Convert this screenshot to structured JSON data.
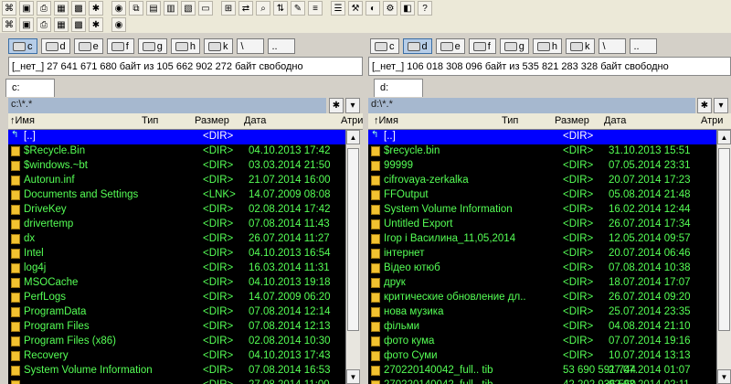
{
  "toolbar1": [
    "cmd-icon",
    "save-icon",
    "print-icon",
    "grid-icon",
    "grid2-icon",
    "star-icon",
    "globe-icon",
    "copy-icon",
    "disk-icon",
    "pack-icon",
    "unpack-icon",
    "terminal-icon",
    "tree-icon",
    "sync-icon",
    "search-icon",
    "ftp-icon",
    "edit-icon",
    "compare-icon",
    "notes-icon",
    "tools-icon",
    "color-icon",
    "settings-icon",
    "view-icon",
    "help-icon"
  ],
  "toolbar2": [
    "network-icon",
    "info-icon",
    "task-icon",
    "clock-icon",
    "web-icon",
    "bug-icon",
    "chip-icon"
  ],
  "left": {
    "drives": [
      {
        "label": "c",
        "active": true
      },
      {
        "label": "d",
        "active": false
      },
      {
        "label": "e",
        "active": false
      },
      {
        "label": "f",
        "active": false
      },
      {
        "label": "g",
        "active": false
      },
      {
        "label": "h",
        "active": false
      },
      {
        "label": "k",
        "active": false
      },
      {
        "label": "\\",
        "active": false
      },
      {
        "label": "..",
        "active": false
      }
    ],
    "free": "[_нет_]  27 641 671 680 байт из 105 662 902 272 байт свободно",
    "tab": "c:",
    "path": "c:\\*.*",
    "rows": [
      {
        "name": "[..]",
        "size": "<DIR>",
        "date": "",
        "up": true,
        "sel": true
      },
      {
        "name": "$Recycle.Bin",
        "size": "<DIR>",
        "date": "04.10.2013 17:42"
      },
      {
        "name": "$windows.~bt",
        "size": "<DIR>",
        "date": "03.03.2014 21:50"
      },
      {
        "name": "Autorun.inf",
        "size": "<DIR>",
        "date": "21.07.2014 16:00"
      },
      {
        "name": "Documents and Settings",
        "size": "<LNK>",
        "date": "14.07.2009 08:08"
      },
      {
        "name": "DriveKey",
        "size": "<DIR>",
        "date": "02.08.2014 17:42"
      },
      {
        "name": "drivertemp",
        "size": "<DIR>",
        "date": "07.08.2014 11:43"
      },
      {
        "name": "dx",
        "size": "<DIR>",
        "date": "26.07.2014 11:27"
      },
      {
        "name": "Intel",
        "size": "<DIR>",
        "date": "04.10.2013 16:54"
      },
      {
        "name": "log4j",
        "size": "<DIR>",
        "date": "16.03.2014 11:31"
      },
      {
        "name": "MSOCache",
        "size": "<DIR>",
        "date": "04.10.2013 19:18"
      },
      {
        "name": "PerfLogs",
        "size": "<DIR>",
        "date": "14.07.2009 06:20"
      },
      {
        "name": "ProgramData",
        "size": "<DIR>",
        "date": "07.08.2014 12:14"
      },
      {
        "name": "Program Files",
        "size": "<DIR>",
        "date": "07.08.2014 12:13"
      },
      {
        "name": "Program Files (x86)",
        "size": "<DIR>",
        "date": "02.08.2014 10:30"
      },
      {
        "name": "Recovery",
        "size": "<DIR>",
        "date": "04.10.2013 17:43"
      },
      {
        "name": "System Volume Information",
        "size": "<DIR>",
        "date": "07.08.2014 16:53"
      },
      {
        "name": "",
        "size": "<DIR>",
        "date": "27.08.2014 11:00"
      }
    ]
  },
  "right": {
    "drives": [
      {
        "label": "c",
        "active": false
      },
      {
        "label": "d",
        "active": true
      },
      {
        "label": "e",
        "active": false
      },
      {
        "label": "f",
        "active": false
      },
      {
        "label": "g",
        "active": false
      },
      {
        "label": "h",
        "active": false
      },
      {
        "label": "k",
        "active": false
      },
      {
        "label": "\\",
        "active": false
      },
      {
        "label": "..",
        "active": false
      }
    ],
    "free": "[_нет_]  106 018 308 096 байт из 535 821 283 328 байт свободно",
    "tab": "d:",
    "path": "d:\\*.*",
    "rows": [
      {
        "name": "[..]",
        "size": "<DIR>",
        "date": "",
        "up": true,
        "sel": true
      },
      {
        "name": "$recycle.bin",
        "size": "<DIR>",
        "date": "31.10.2013 15:51"
      },
      {
        "name": "99999",
        "size": "<DIR>",
        "date": "07.05.2014 23:31"
      },
      {
        "name": "cifrovaya-zerkalka",
        "size": "<DIR>",
        "date": "20.07.2014 17:23"
      },
      {
        "name": "FFOutput",
        "size": "<DIR>",
        "date": "05.08.2014 21:48"
      },
      {
        "name": "System Volume Information",
        "size": "<DIR>",
        "date": "16.02.2014 12:44"
      },
      {
        "name": "Untitled Export",
        "size": "<DIR>",
        "date": "26.07.2014 17:34"
      },
      {
        "name": "Ігор і Василина_11,05,2014",
        "size": "<DIR>",
        "date": "12.05.2014 09:57"
      },
      {
        "name": "інтернет",
        "size": "<DIR>",
        "date": "20.07.2014 06:46"
      },
      {
        "name": "Відео ютюб",
        "size": "<DIR>",
        "date": "07.08.2014 10:38"
      },
      {
        "name": "друк",
        "size": "<DIR>",
        "date": "18.07.2014 17:07"
      },
      {
        "name": "критические обновление дл..",
        "size": "<DIR>",
        "date": "26.07.2014 09:20"
      },
      {
        "name": "нова музика",
        "size": "<DIR>",
        "date": "25.07.2014 23:35"
      },
      {
        "name": "фільми",
        "size": "<DIR>",
        "date": "04.08.2014 21:10"
      },
      {
        "name": "фото кума",
        "size": "<DIR>",
        "date": "07.07.2014 19:16"
      },
      {
        "name": "фото Суми",
        "size": "<DIR>",
        "date": "10.07.2014 13:13"
      },
      {
        "name": "270220140042_full.. tib",
        "size": "53 690 591 744",
        "date": "27.07.2014 01:07"
      },
      {
        "name": "270220140042_full.. tib",
        "size": "42 202 936 560",
        "date": "02.03.2014 02:11"
      }
    ]
  },
  "columns": {
    "name": "↑Имя",
    "type": "Тип",
    "size": "Размер",
    "date": "Дата",
    "attr": "Атри"
  },
  "colors": {
    "list_bg": "#000000",
    "list_text": "#55ff55",
    "selection": "#0000ff",
    "path_bg": "#a6b8cf"
  }
}
